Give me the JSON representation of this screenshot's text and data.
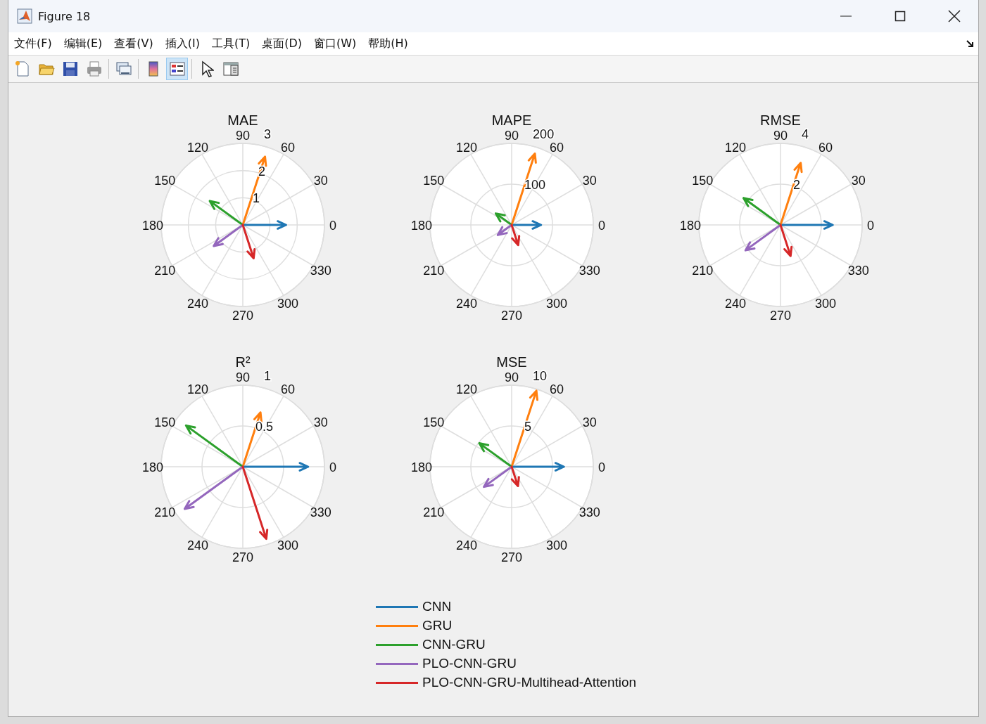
{
  "window": {
    "title": "Figure 18"
  },
  "menu": [
    {
      "label": "文件(F)"
    },
    {
      "label": "编辑(E)"
    },
    {
      "label": "查看(V)"
    },
    {
      "label": "插入(I)"
    },
    {
      "label": "工具(T)"
    },
    {
      "label": "桌面(D)"
    },
    {
      "label": "窗口(W)"
    },
    {
      "label": "帮助(H)"
    }
  ],
  "toolbar": [
    {
      "kind": "new",
      "selected": false
    },
    {
      "kind": "open",
      "selected": false
    },
    {
      "kind": "save",
      "selected": false
    },
    {
      "kind": "print",
      "selected": false
    },
    {
      "kind": "link",
      "selected": false
    },
    {
      "kind": "colorbar",
      "selected": false
    },
    {
      "kind": "legend",
      "selected": true
    },
    {
      "kind": "pointer",
      "selected": false
    },
    {
      "kind": "panel",
      "selected": false
    }
  ],
  "plots": [
    {
      "title": "MAE",
      "angle_labels": [
        "0",
        "30",
        "60",
        "90",
        "120",
        "150",
        "180",
        "210",
        "240",
        "270",
        "300",
        "330"
      ],
      "ring_labels": [
        "3",
        "2",
        "1"
      ]
    },
    {
      "title": "MAPE",
      "angle_labels": [
        "0",
        "30",
        "60",
        "90",
        "120",
        "150",
        "180",
        "210",
        "240",
        "270",
        "300",
        "330"
      ],
      "ring_labels": [
        "200",
        "100"
      ]
    },
    {
      "title": "RMSE",
      "angle_labels": [
        "0",
        "30",
        "60",
        "90",
        "120",
        "150",
        "180",
        "210",
        "240",
        "270",
        "300",
        "330"
      ],
      "ring_labels": [
        "4",
        "2"
      ]
    },
    {
      "title": "R²",
      "angle_labels": [
        "0",
        "30",
        "60",
        "90",
        "120",
        "150",
        "180",
        "210",
        "240",
        "270",
        "300",
        "330"
      ],
      "ring_labels": [
        "1",
        "0.5"
      ]
    },
    {
      "title": "MSE",
      "angle_labels": [
        "0",
        "30",
        "60",
        "90",
        "120",
        "150",
        "180",
        "210",
        "240",
        "270",
        "300",
        "330"
      ],
      "ring_labels": [
        "10",
        "5"
      ]
    }
  ],
  "legend": [
    {
      "label": "CNN",
      "color": "#1f77b4"
    },
    {
      "label": "GRU",
      "color": "#ff7f0e"
    },
    {
      "label": "CNN-GRU",
      "color": "#2ca02c"
    },
    {
      "label": "PLO-CNN-GRU",
      "color": "#9467bd"
    },
    {
      "label": "PLO-CNN-GRU-Multihead-Attention",
      "color": "#d62728"
    }
  ]
}
